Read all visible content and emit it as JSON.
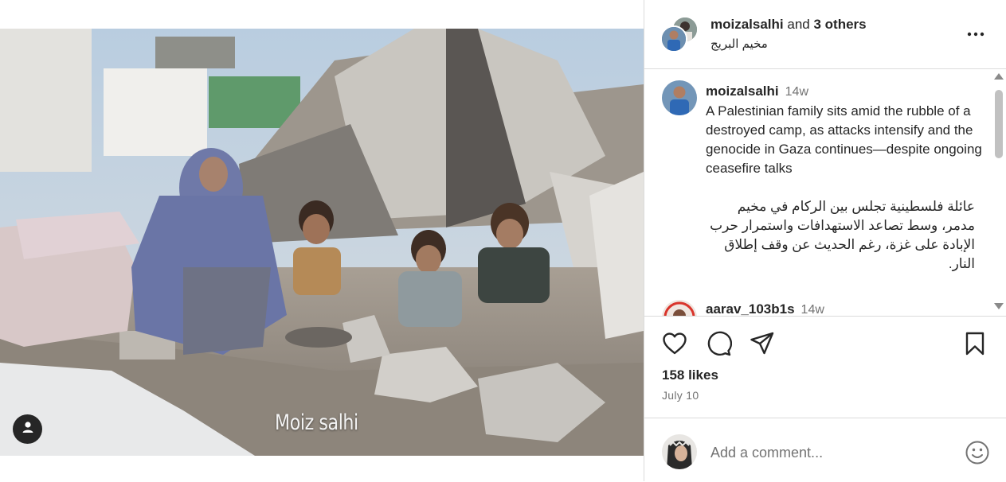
{
  "post": {
    "watermark": "Moiz salhi"
  },
  "header": {
    "username": "moizalsalhi",
    "joiner": "and",
    "others": "3 others",
    "location": "مخيم البريج"
  },
  "caption": {
    "username": "moizalsalhi",
    "time": "14w",
    "text_en": "A Palestinian family sits amid the rubble of a destroyed camp, as attacks intensify and the genocide in Gaza continues—despite ongoing ceasefire talks",
    "text_ar": "عائلة فلسطينية تجلس بين الركام في مخيم مدمر، وسط تصاعد الاستهدافات واستمرار حرب الإبادة على غزة، رغم الحديث عن وقف إطلاق النار."
  },
  "next_comment": {
    "username": "aarav_103b1s",
    "time": "14w"
  },
  "stats": {
    "likes": "158 likes",
    "date": "July 10"
  },
  "add_comment": {
    "placeholder": "Add a comment..."
  },
  "icons": {
    "like": "heart-icon",
    "comment": "comment-icon",
    "share": "send-icon",
    "save": "bookmark-icon",
    "more": "more-dots-icon",
    "tag": "user-tag-icon",
    "emoji": "emoji-icon"
  },
  "colors": {
    "text": "#262626",
    "secondary": "#737373",
    "border": "#dbdbdb"
  }
}
